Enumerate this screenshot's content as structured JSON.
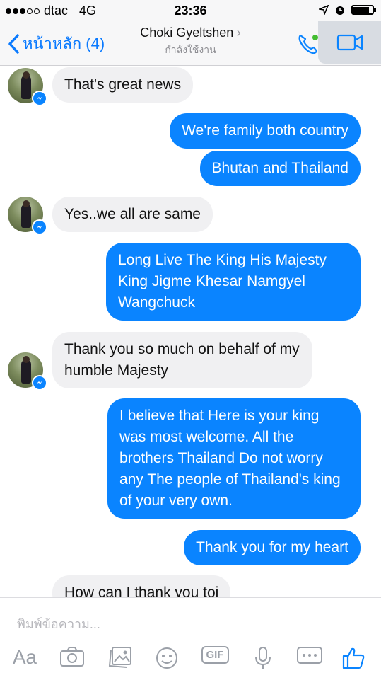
{
  "status_bar": {
    "carrier": "dtac",
    "network": "4G",
    "time": "23:36",
    "battery_level": 0.85,
    "signal_bars_filled": 3,
    "signal_bars_total": 5
  },
  "nav": {
    "back_label": "หน้าหลัก (4)",
    "contact_name": "Choki Gyeltshen",
    "status": "กำลังใช้งาน"
  },
  "messages": [
    {
      "direction": "incoming",
      "text": "That's great news"
    },
    {
      "direction": "outgoing",
      "text": "We're family both country"
    },
    {
      "direction": "outgoing",
      "text": "Bhutan and Thailand"
    },
    {
      "direction": "incoming",
      "text": "Yes..we all are same"
    },
    {
      "direction": "outgoing",
      "text": "Long Live The King His Majesty King Jigme Khesar Namgyel Wangchuck"
    },
    {
      "direction": "incoming",
      "text": "Thank you so much on behalf of my humble Majesty"
    },
    {
      "direction": "outgoing",
      "text": "I believe that Here is your king was most welcome. All the brothers Thailand Do not worry any The people of Thailand's king of your very own."
    },
    {
      "direction": "outgoing",
      "text": "Thank you for my heart"
    },
    {
      "direction": "incoming",
      "text": "How can I thank you toi"
    }
  ],
  "composer": {
    "placeholder": "พิมพ์ข้อความ...",
    "aa_label": "Aa",
    "gif_label": "GIF"
  },
  "colors": {
    "accent": "#0a84ff",
    "incoming_bubble": "#f0f0f2",
    "online": "#44bd32"
  },
  "icons": [
    "location-arrow-icon",
    "alarm-icon",
    "battery-icon",
    "back-chevron-icon",
    "phone-icon",
    "video-camera-icon",
    "camera-icon",
    "gallery-icon",
    "emoji-icon",
    "gif-icon",
    "microphone-icon",
    "more-icon",
    "thumbs-up-icon"
  ]
}
